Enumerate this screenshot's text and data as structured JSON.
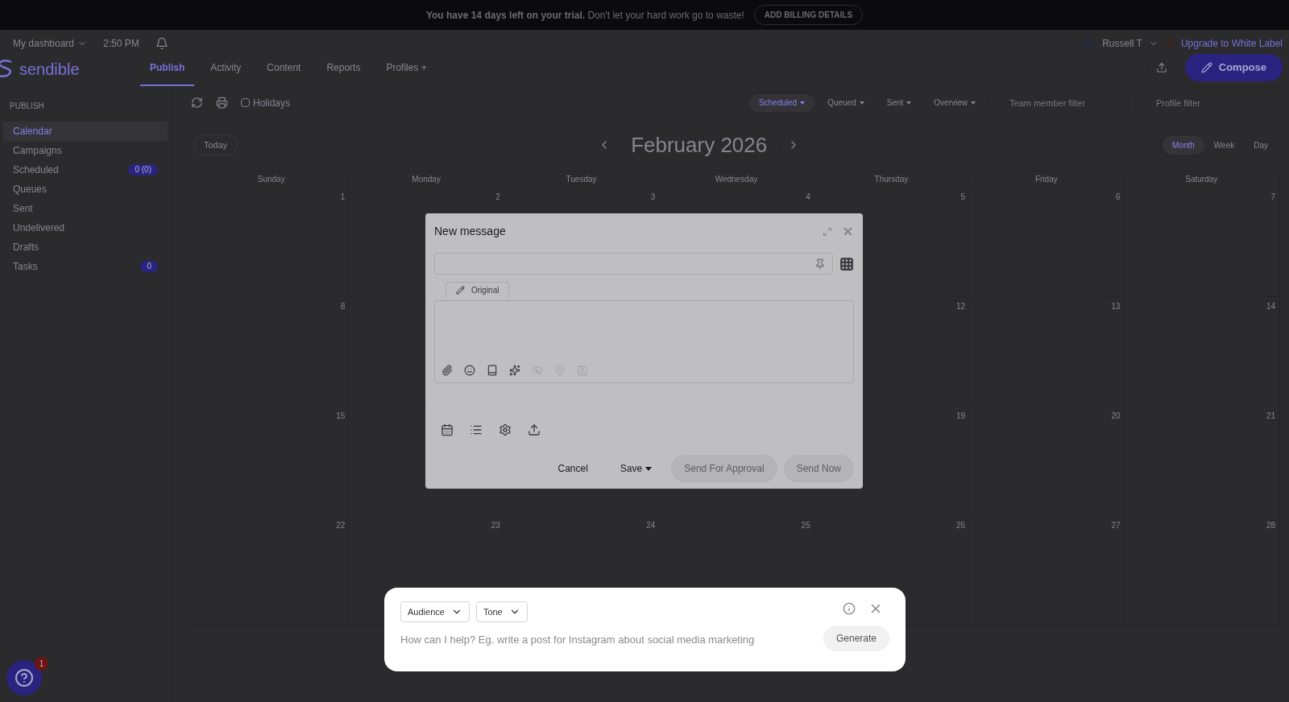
{
  "banner": {
    "bold": "You have 14 days left on your trial.",
    "text": "Don't let your hard work go to waste!",
    "button": "ADD BILLING DETAILS"
  },
  "header": {
    "logo": "sendible",
    "dashboard": "My dashboard",
    "time": "2:50 PM",
    "user": "Russell T",
    "upgrade": "Upgrade to White Label",
    "compose": "Compose",
    "nav": [
      {
        "label": "Publish",
        "selected": true
      },
      {
        "label": "Activity",
        "selected": false
      },
      {
        "label": "Content",
        "selected": false
      },
      {
        "label": "Reports",
        "selected": false
      },
      {
        "label": "Profiles +",
        "selected": false
      }
    ]
  },
  "sidebar": {
    "heading": "PUBLISH",
    "items": [
      {
        "label": "Calendar",
        "selected": true
      },
      {
        "label": "Campaigns",
        "selected": false
      },
      {
        "label": "Scheduled",
        "selected": false,
        "badge": "0 (0)"
      },
      {
        "label": "Queues",
        "selected": false
      },
      {
        "label": "Sent",
        "selected": false
      },
      {
        "label": "Undelivered",
        "selected": false
      },
      {
        "label": "Drafts",
        "selected": false
      },
      {
        "label": "Tasks",
        "selected": false,
        "badge": "0"
      }
    ]
  },
  "toolbar": {
    "holidays": {
      "label": "Holidays",
      "checked": false
    },
    "filters": [
      {
        "label": "Scheduled",
        "selected": true
      },
      {
        "label": "Queued",
        "selected": false
      },
      {
        "label": "Sent",
        "selected": false
      },
      {
        "label": "Overview",
        "selected": false
      }
    ],
    "team_filter": {
      "placeholder": "Team member filter"
    },
    "profile_filter": {
      "placeholder": "Profile filter"
    }
  },
  "calendar": {
    "today": "Today",
    "title": "February 2026",
    "views": [
      {
        "label": "Month",
        "selected": true
      },
      {
        "label": "Week",
        "selected": false
      },
      {
        "label": "Day",
        "selected": false
      }
    ],
    "weekdays": [
      "Sunday",
      "Monday",
      "Tuesday",
      "Wednesday",
      "Thursday",
      "Friday",
      "Saturday"
    ],
    "weeks": [
      {
        "sun": "1",
        "mon": "2",
        "tue": "3",
        "wed": "4",
        "thu": "5",
        "fri": "6",
        "sat": "7"
      },
      {
        "sun": "8",
        "thu": "12",
        "fri": "13",
        "sat": "14"
      },
      {
        "sun": "15",
        "thu": "19",
        "fri": "20",
        "sat": "21"
      },
      {
        "sun": "22",
        "mon": "23",
        "tue": "24",
        "wed": "25",
        "thu": "26",
        "fri": "27",
        "sat": "28"
      }
    ]
  },
  "modal": {
    "title": "New message",
    "tab": "Original",
    "cancel": "Cancel",
    "save": "Save",
    "send_for_approval": {
      "label": "Send For Approval",
      "disabled": true
    },
    "send_now": {
      "label": "Send Now",
      "disabled": true
    }
  },
  "assistant": {
    "audience": "Audience",
    "tone": "Tone",
    "placeholder": "How can I help? Eg. write a post for Instagram about social media marketing",
    "generate": "Generate"
  },
  "help": {
    "badge": "1"
  }
}
